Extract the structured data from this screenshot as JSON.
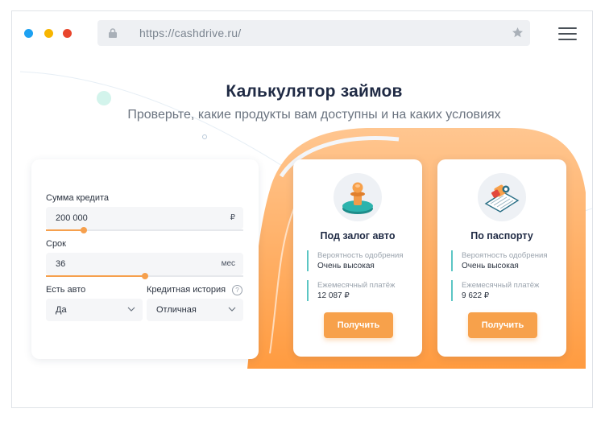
{
  "browser": {
    "url": "https://cashdrive.ru/"
  },
  "page": {
    "title": "Калькулятор займов",
    "subtitle": "Проверьте, какие продукты вам доступны и на каких условиях"
  },
  "calculator": {
    "amount_label": "Сумма кредита",
    "amount_value": "200 000",
    "amount_unit": "₽",
    "amount_slider_fraction": 0.19,
    "term_label": "Срок",
    "term_value": "36",
    "term_unit": "мес",
    "term_slider_fraction": 0.5,
    "has_car_label": "Есть авто",
    "has_car_value": "Да",
    "credit_history_label": "Кредитная история",
    "credit_history_value": "Отличная",
    "help_symbol": "?"
  },
  "products": [
    {
      "title": "Под залог авто",
      "icon": "stamp-icon",
      "approval_label": "Вероятность одобрения",
      "approval_value": "Очень высокая",
      "payment_label": "Ежемесячный платёж",
      "payment_value": "12 087 ₽",
      "button_label": "Получить"
    },
    {
      "title": "По паспорту",
      "icon": "passport-icon",
      "approval_label": "Вероятность одобрения",
      "approval_value": "Очень высокая",
      "payment_label": "Ежемесячный платёж",
      "payment_value": "9 622 ₽",
      "button_label": "Получить"
    }
  ],
  "colors": {
    "accent": "#f7a14b",
    "teal": "#5cc6c4",
    "title": "#1f2a44"
  }
}
